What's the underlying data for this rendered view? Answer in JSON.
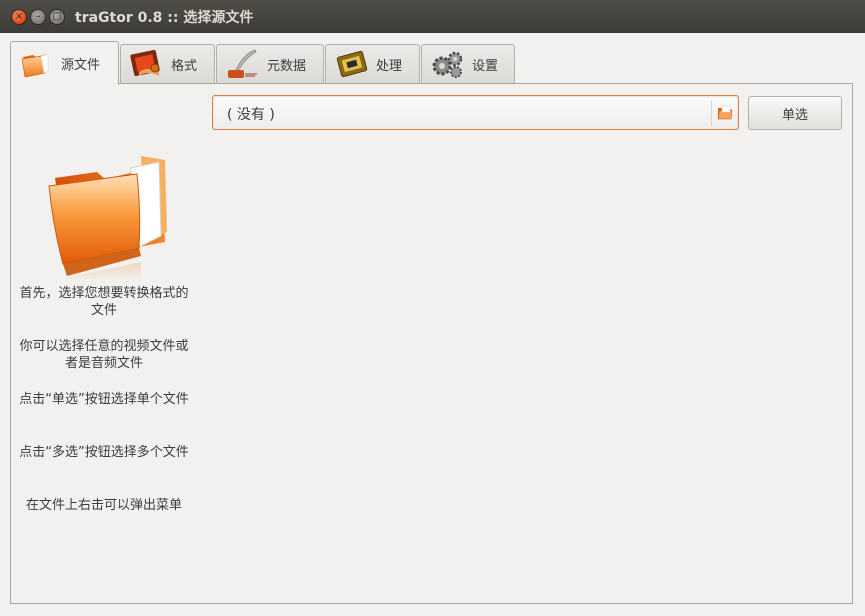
{
  "window": {
    "title": "traGtor 0.8 :: 选择源文件",
    "close_glyph": "×",
    "minimize_glyph": "–",
    "maximize_glyph": "□"
  },
  "tabs": [
    {
      "label": "源文件",
      "icon": "folder-icon",
      "active": true
    },
    {
      "label": "格式",
      "icon": "film-icon",
      "active": false
    },
    {
      "label": "元数据",
      "icon": "quill-pen-icon",
      "active": false
    },
    {
      "label": "处理",
      "icon": "chip-icon",
      "active": false
    },
    {
      "label": "设置",
      "icon": "gears-icon",
      "active": false
    }
  ],
  "source": {
    "file_value": "( 没有 )",
    "single_button": "单选"
  },
  "help": {
    "line1": "首先，选择您想要转换格式的文件",
    "line2": "你可以选择任意的视频文件或者是音频文件",
    "line3": "点击“单选”按钮选择单个文件",
    "line4": "点击“多选”按钮选择多个文件",
    "line5": "在文件上右击可以弹出菜单"
  },
  "colors": {
    "accent": "#dd4814",
    "titlebar": "#3c3b37",
    "window_bg": "#f2f1f0"
  }
}
